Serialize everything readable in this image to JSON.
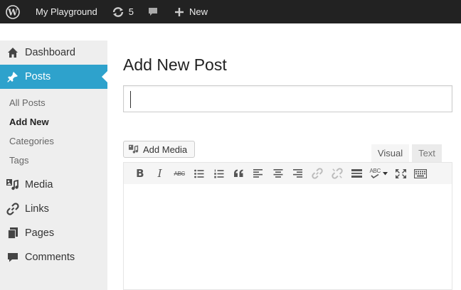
{
  "adminbar": {
    "site_name": "My Playground",
    "updates_count": "5",
    "new_label": "New"
  },
  "sidebar": {
    "items": [
      {
        "label": "Dashboard",
        "icon": "dashboard-icon"
      },
      {
        "label": "Posts",
        "icon": "pushpin-icon",
        "current": true
      },
      {
        "label": "Media",
        "icon": "media-icon"
      },
      {
        "label": "Links",
        "icon": "link-icon"
      },
      {
        "label": "Pages",
        "icon": "pages-icon"
      },
      {
        "label": "Comments",
        "icon": "comment-icon"
      }
    ],
    "posts_submenu": [
      {
        "label": "All Posts"
      },
      {
        "label": "Add New",
        "active": true
      },
      {
        "label": "Categories"
      },
      {
        "label": "Tags"
      }
    ]
  },
  "main": {
    "page_title": "Add New Post",
    "title_value": "",
    "add_media_label": "Add Media",
    "tabs": {
      "visual": "Visual",
      "text": "Text"
    },
    "toolbar": {
      "bold": "B",
      "italic": "I",
      "strikethrough": "ABC",
      "spellcheck": "ABC"
    }
  },
  "colors": {
    "adminbar_bg": "#222222",
    "accent": "#2ea2cc",
    "sidebar_bg": "#eeeeee"
  }
}
